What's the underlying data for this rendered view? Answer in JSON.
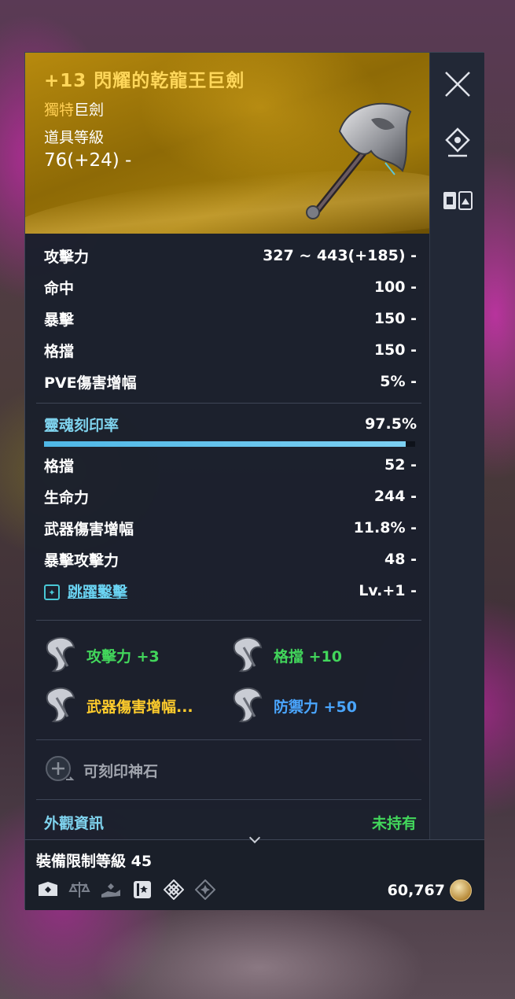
{
  "item": {
    "name": "+13 閃耀的乾龍王巨劍",
    "grade_prefix": "獨特",
    "grade_type": "巨劍",
    "level_label": "道具等級",
    "level_value": "76(+24) -"
  },
  "base_stats": [
    {
      "label": "攻擊力",
      "value": "327 ~ 443(+185) -"
    },
    {
      "label": "命中",
      "value": "100 -"
    },
    {
      "label": "暴擊",
      "value": "150 -"
    },
    {
      "label": "格擋",
      "value": "150 -"
    },
    {
      "label": "PVE傷害增幅",
      "value": "5% -"
    }
  ],
  "soul": {
    "label": "靈魂刻印率",
    "value": "97.5%",
    "progress": 0.975
  },
  "soul_stats": [
    {
      "label": "格擋",
      "value": "52 -"
    },
    {
      "label": "生命力",
      "value": "244 -"
    },
    {
      "label": "武器傷害增幅",
      "value": "11.8% -"
    },
    {
      "label": "暴擊攻擊力",
      "value": "48 -"
    }
  ],
  "skill": {
    "label": "跳躍鑿擊",
    "value": "Lv.+1 -"
  },
  "engravings": [
    {
      "text": "攻擊力 +3",
      "color": "#42d65b"
    },
    {
      "text": "格擋 +10",
      "color": "#42d65b"
    },
    {
      "text": "武器傷害增幅...",
      "color": "#ffcc2c"
    },
    {
      "text": "防禦力 +50",
      "color": "#4aa6ff"
    }
  ],
  "stone": {
    "label": "可刻印神石"
  },
  "appearance": {
    "label": "外觀資訊",
    "status": "未持有"
  },
  "footer": {
    "requirement": "裝備限制等級 45",
    "price": "60,767",
    "icons": [
      "shield-bind-icon",
      "balance-scale-icon",
      "hand-give-icon",
      "book-icon",
      "diamond-pattern-icon",
      "diamond-star-icon"
    ]
  },
  "colors": {
    "accent_gold": "#ffd75a",
    "soul_blue": "#7fd3ee",
    "green": "#42d65b",
    "blue": "#4aa6ff",
    "yellow": "#ffcc2c"
  }
}
